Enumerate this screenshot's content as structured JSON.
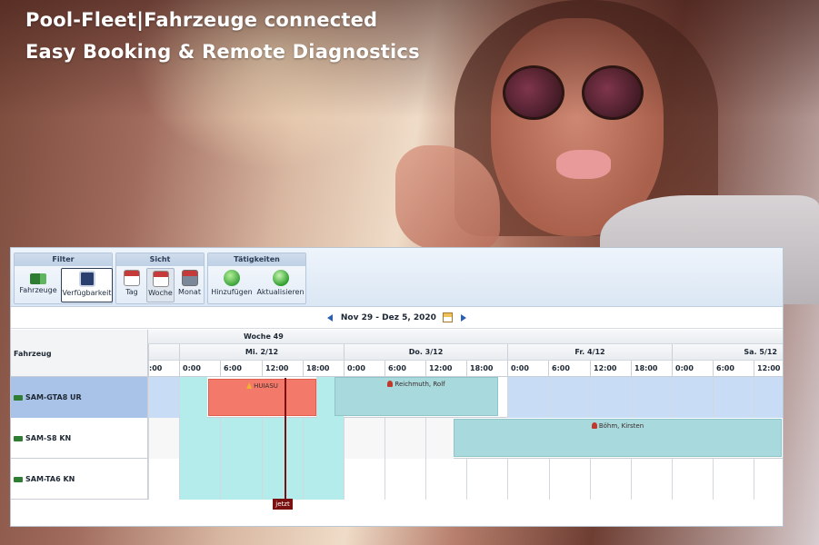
{
  "hero": {
    "title_line1": "Pool-Fleet|Fahrzeuge connected",
    "title_line2": "Easy Booking & Remote Diagnostics"
  },
  "toolbar": {
    "groups": [
      {
        "title": "Filter",
        "buttons": [
          {
            "label": "Fahrzeuge",
            "icon": "truck-icon"
          },
          {
            "label": "Verfügbarkeit",
            "icon": "availability-icon",
            "active": true
          }
        ]
      },
      {
        "title": "Sicht",
        "buttons": [
          {
            "label": "Tag",
            "icon": "calendar-icon"
          },
          {
            "label": "Woche",
            "icon": "calendar-icon",
            "pressed": true
          },
          {
            "label": "Monat",
            "icon": "calendar-icon"
          }
        ]
      },
      {
        "title": "Tätigkeiten",
        "buttons": [
          {
            "label": "Hinzufügen",
            "icon": "add-icon"
          },
          {
            "label": "Aktualisieren",
            "icon": "refresh-icon"
          }
        ]
      }
    ]
  },
  "nav": {
    "range": "Nov 29 - Dez 5, 2020"
  },
  "grid": {
    "vehicle_header": "Fahrzeug",
    "week": "Woche 49",
    "days": [
      "Mi. 2/12",
      "Do. 3/12",
      "Fr. 4/12",
      "Sa. 5/12"
    ],
    "first_hour": ":00",
    "hours": [
      "0:00",
      "6:00",
      "12:00",
      "18:00"
    ],
    "vehicles": [
      "SAM-GTA8 UR",
      "SAM-S8 KN",
      "SAM-TA6 KN"
    ],
    "bookings": {
      "b1": "HUIASU",
      "b2": "Reichmuth, Rolf",
      "b3": "Böhm, Kirsten"
    },
    "now_label": "jetzt"
  },
  "colors": {
    "booking_red": "#f37a6a",
    "booking_teal": "#a8d9dc",
    "available_cyan": "#b3ecea",
    "selected_row": "#a9c3e8",
    "now_line": "#7a1010"
  }
}
